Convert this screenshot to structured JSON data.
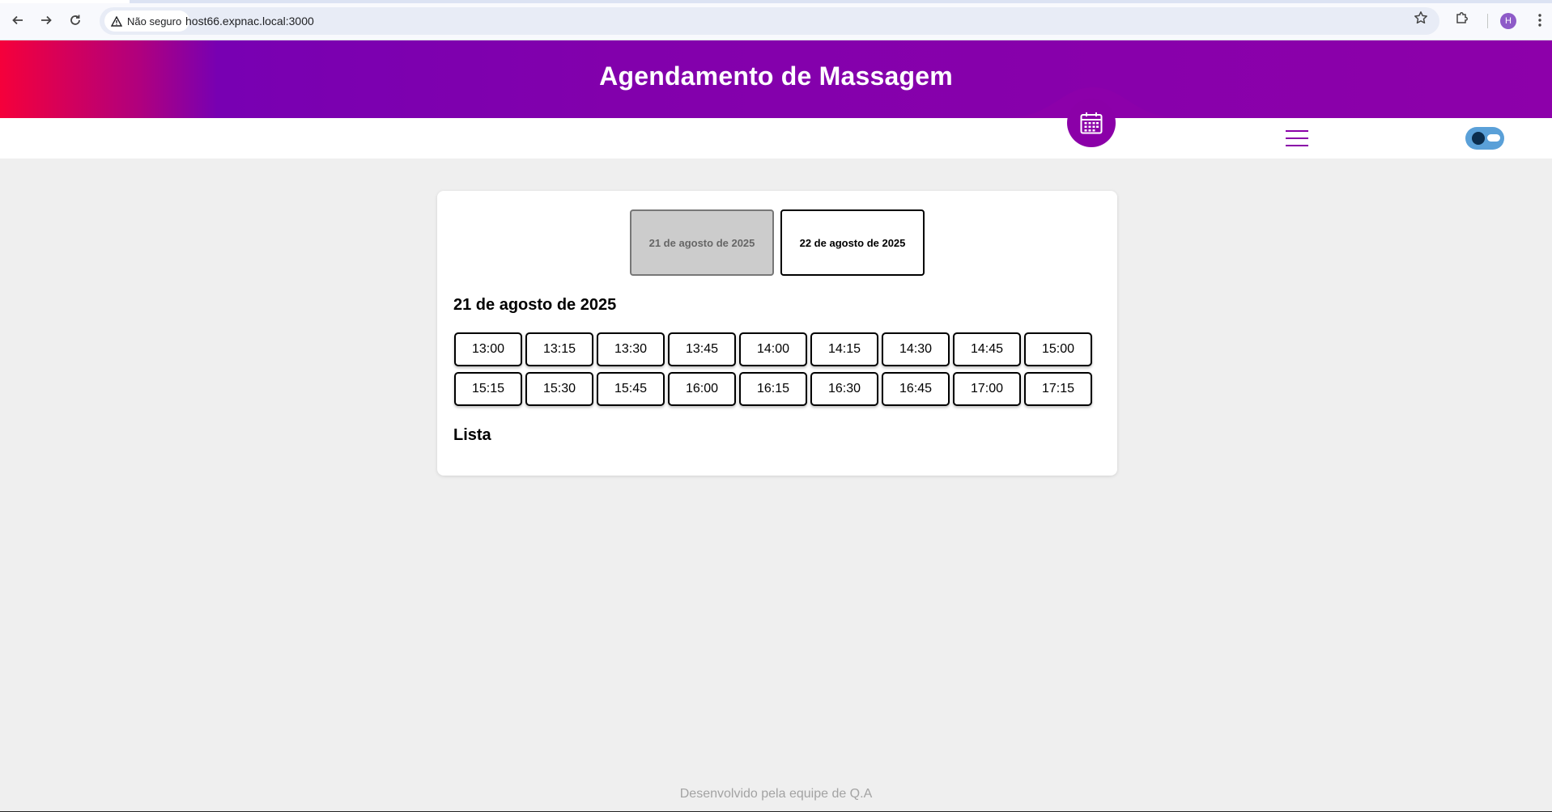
{
  "browser": {
    "security_label": "Não seguro",
    "url": "host66.expnac.local:3000",
    "profile_initial": "H"
  },
  "header": {
    "title": "Agendamento de Massagem",
    "icons": {
      "calendar": "calendar-icon",
      "menu": "hamburger-menu-icon",
      "theme": "theme-toggle"
    },
    "colors": {
      "primary": "#8b00a8",
      "gradient_start": "#f5003b",
      "gradient_mid": "#7800b2"
    }
  },
  "date_tabs": [
    {
      "label": "21 de agosto de 2025",
      "state": "selected"
    },
    {
      "label": "22 de agosto de 2025",
      "state": "default"
    }
  ],
  "schedule": {
    "selected_date": "21 de agosto de 2025",
    "slots": [
      "13:00",
      "13:15",
      "13:30",
      "13:45",
      "14:00",
      "14:15",
      "14:30",
      "14:45",
      "15:00",
      "15:15",
      "15:30",
      "15:45",
      "16:00",
      "16:15",
      "16:30",
      "16:45",
      "17:00",
      "17:15"
    ]
  },
  "list": {
    "title": "Lista"
  },
  "footer": {
    "text": "Desenvolvido pela equipe de Q.A"
  }
}
